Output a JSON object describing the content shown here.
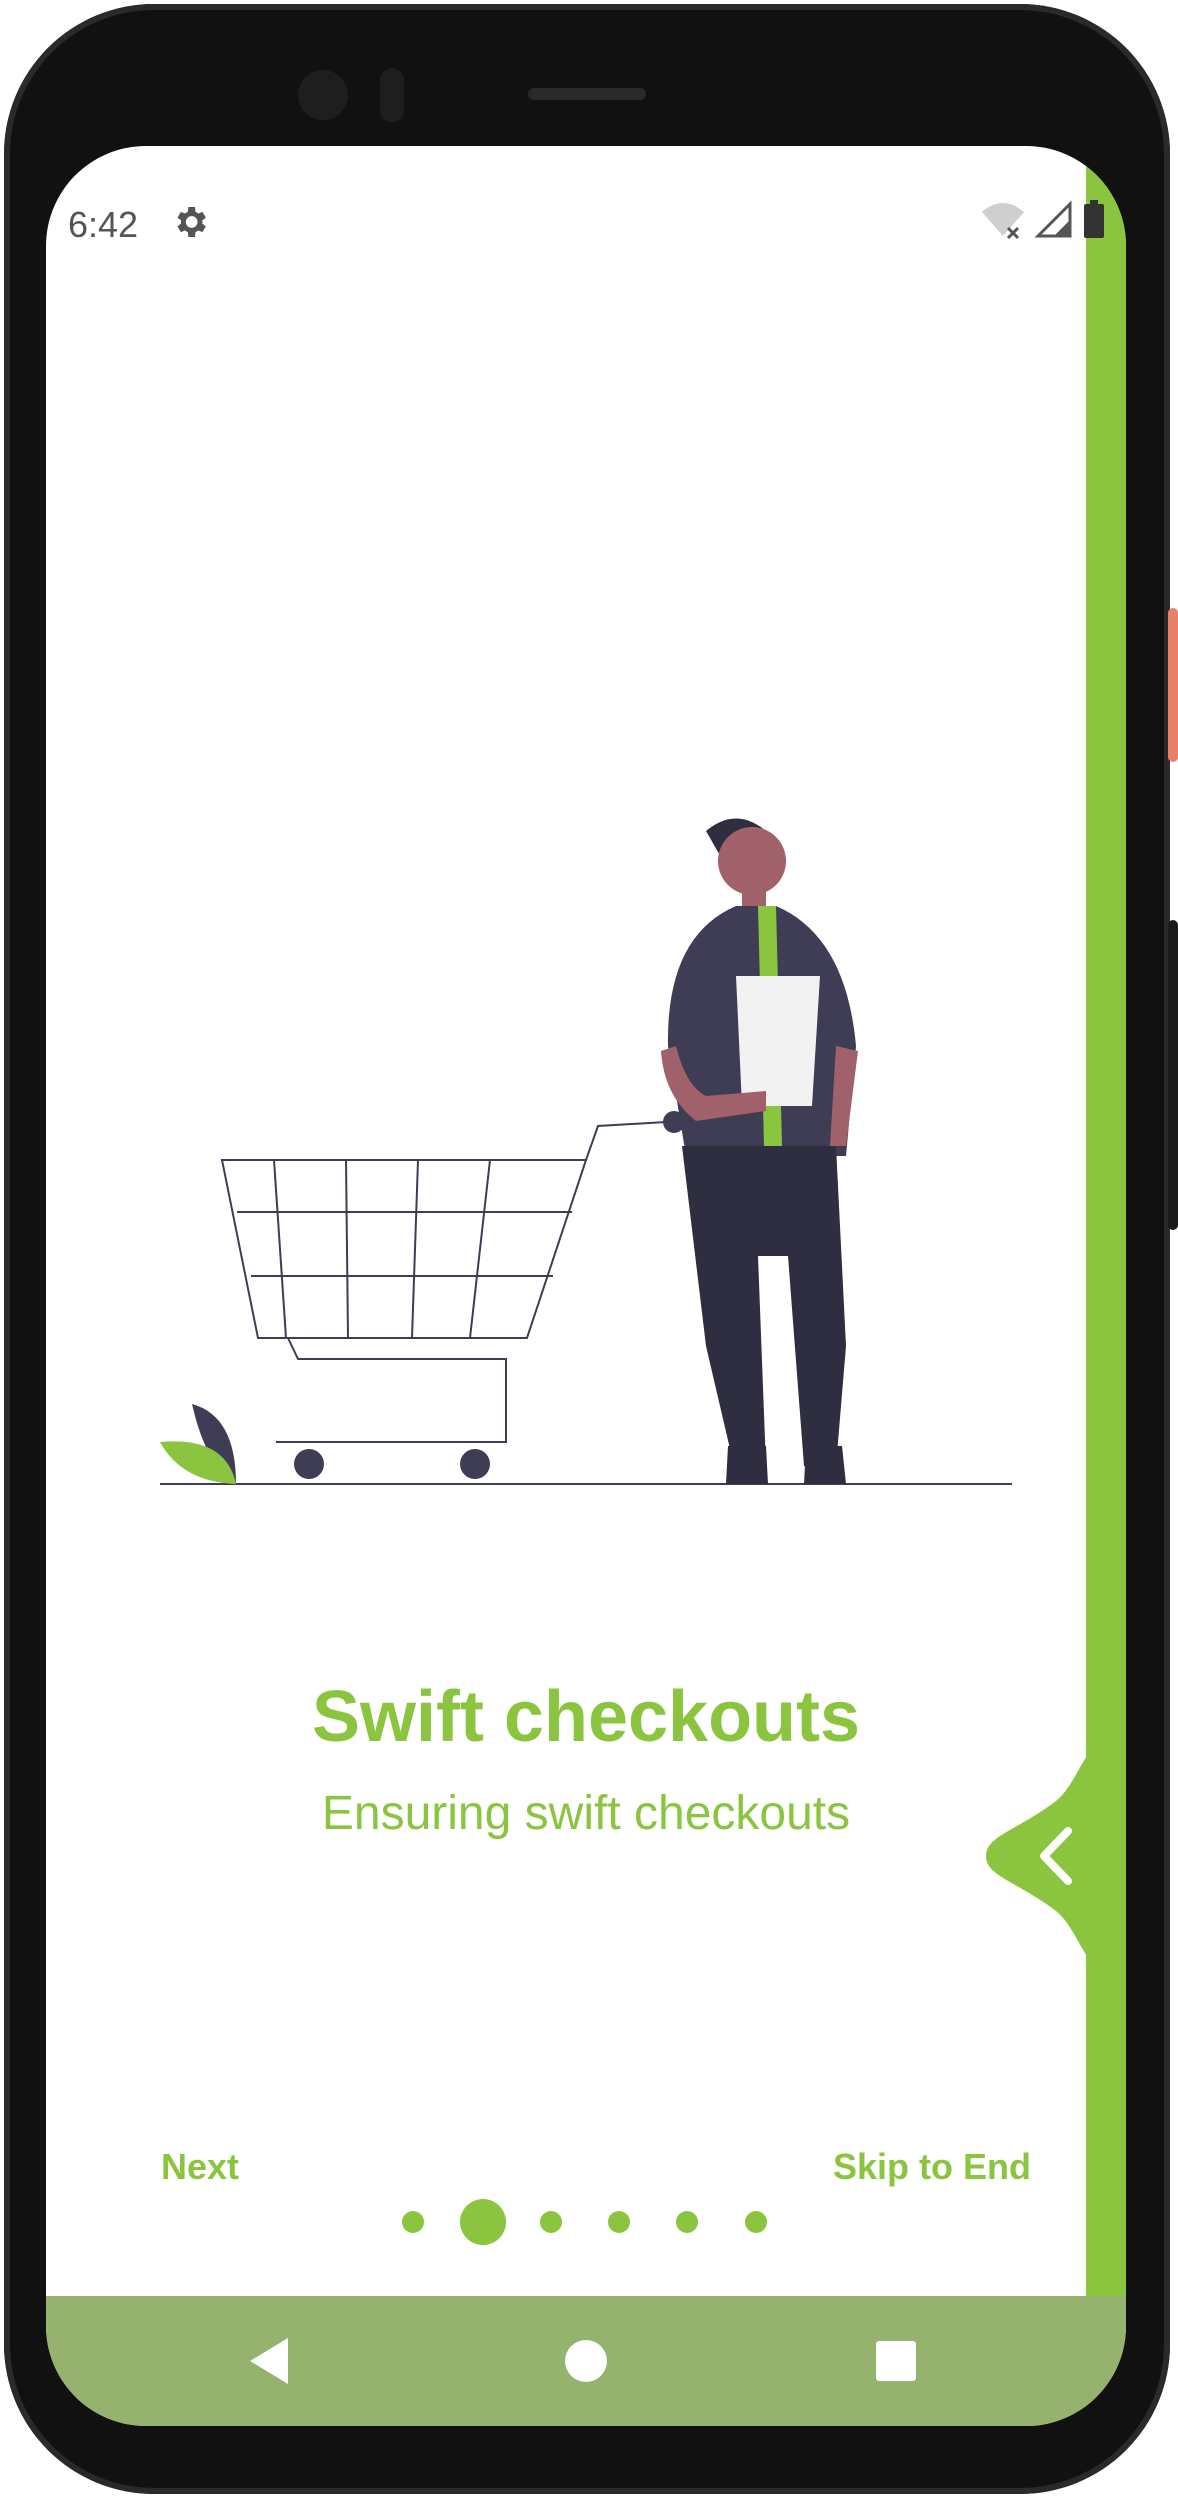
{
  "status_bar": {
    "time": "6:42",
    "icons": [
      "settings-gear-icon",
      "wifi-off-icon",
      "cellular-signal-icon",
      "battery-icon"
    ]
  },
  "onboarding": {
    "title": "Swift checkouts",
    "subtitle": "Ensuring swift checkouts",
    "next_label": "Next",
    "skip_label": "Skip to End",
    "page_count": 6,
    "current_page": 2,
    "back_tab_icon": "chevron-left-icon"
  },
  "nav_bar": {
    "buttons": [
      "back-triangle-icon",
      "home-circle-icon",
      "recents-square-icon"
    ]
  },
  "colors": {
    "accent": "#8bc53f",
    "nav_bar": "#96b26f",
    "figure_dark": "#3f3d56",
    "skin": "#a0616a"
  }
}
